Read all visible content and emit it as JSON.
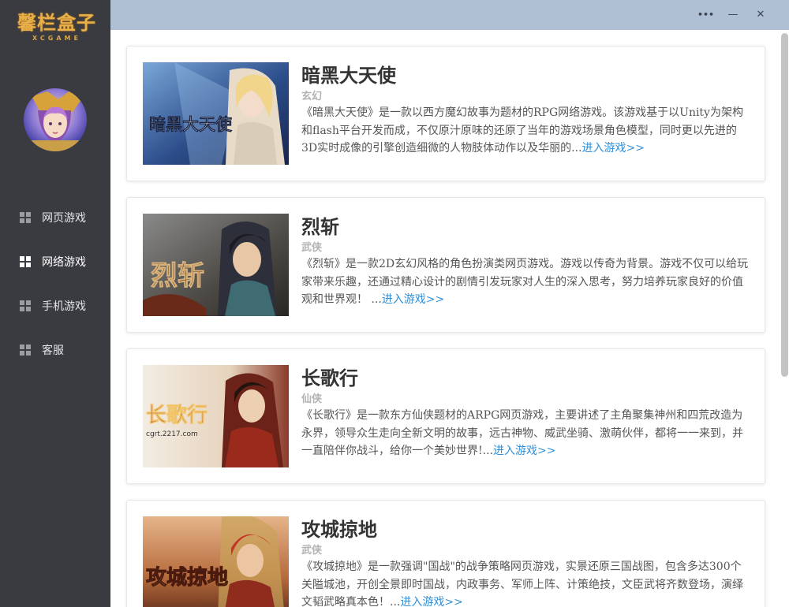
{
  "app": {
    "logo_text": "馨栏盒子",
    "logo_sub": "XCGAME"
  },
  "window_controls": {
    "more": "•••",
    "minimize": "—",
    "close": "✕"
  },
  "sidebar": {
    "items": [
      {
        "label": "网页游戏",
        "icon": "grid-icon",
        "active": false
      },
      {
        "label": "网络游戏",
        "icon": "grid-icon",
        "active": true
      },
      {
        "label": "手机游戏",
        "icon": "grid-icon",
        "active": false
      },
      {
        "label": "客服",
        "icon": "grid-icon",
        "active": false
      }
    ]
  },
  "games": [
    {
      "title": "暗黑大天使",
      "category": "玄幻",
      "description": "《暗黑大天使》是一款以西方魔幻故事为题材的RPG网络游戏。该游戏基于以Unity为架构和flash平台开发而成，不仅原汁原味的还原了当年的游戏场景角色模型，同时更以先进的3D实时成像的引擎创造细微的人物肢体动作以及华丽的...",
      "link": "进入游戏>>",
      "thumb_text": "暗黑大天使"
    },
    {
      "title": "烈斩",
      "category": "武侠",
      "description": "《烈斩》是一款2D玄幻风格的角色扮演类网页游戏。游戏以传奇为背景。游戏不仅可以给玩家带来乐趣，还通过精心设计的剧情引发玩家对人生的深入思考，努力培养玩家良好的价值观和世界观！ ...",
      "link": "进入游戏>>",
      "thumb_text": "烈斩"
    },
    {
      "title": "长歌行",
      "category": "仙侠",
      "description": "《长歌行》是一款东方仙侠题材的ARPG网页游戏，主要讲述了主角聚集神州和四荒改造为永界，领导众生走向全新文明的故事，远古神物、威武坐骑、激萌伙伴，都将一一来到，并一直陪伴你战斗，给你一个美妙世界!...",
      "link": "进入游戏>>",
      "thumb_text": "长歌行",
      "thumb_subtext": "cgrt.2217.com"
    },
    {
      "title": "攻城掠地",
      "category": "武侠",
      "description": "《攻城掠地》是一款强调\"国战\"的战争策略网页游戏，实景还原三国战图，包含多达300个关隘城池，开创全景即时国战，内政事务、军师上阵、计策绝技，文臣武将齐数登场，演绎文韬武略真本色！...",
      "link": "进入游戏>>",
      "thumb_text": "攻城掠地"
    }
  ],
  "colors": {
    "sidebar_bg": "#3a3b40",
    "topbar_bg": "#b0c0d4",
    "link": "#2f8fd8",
    "logo": "#e8b04a"
  }
}
